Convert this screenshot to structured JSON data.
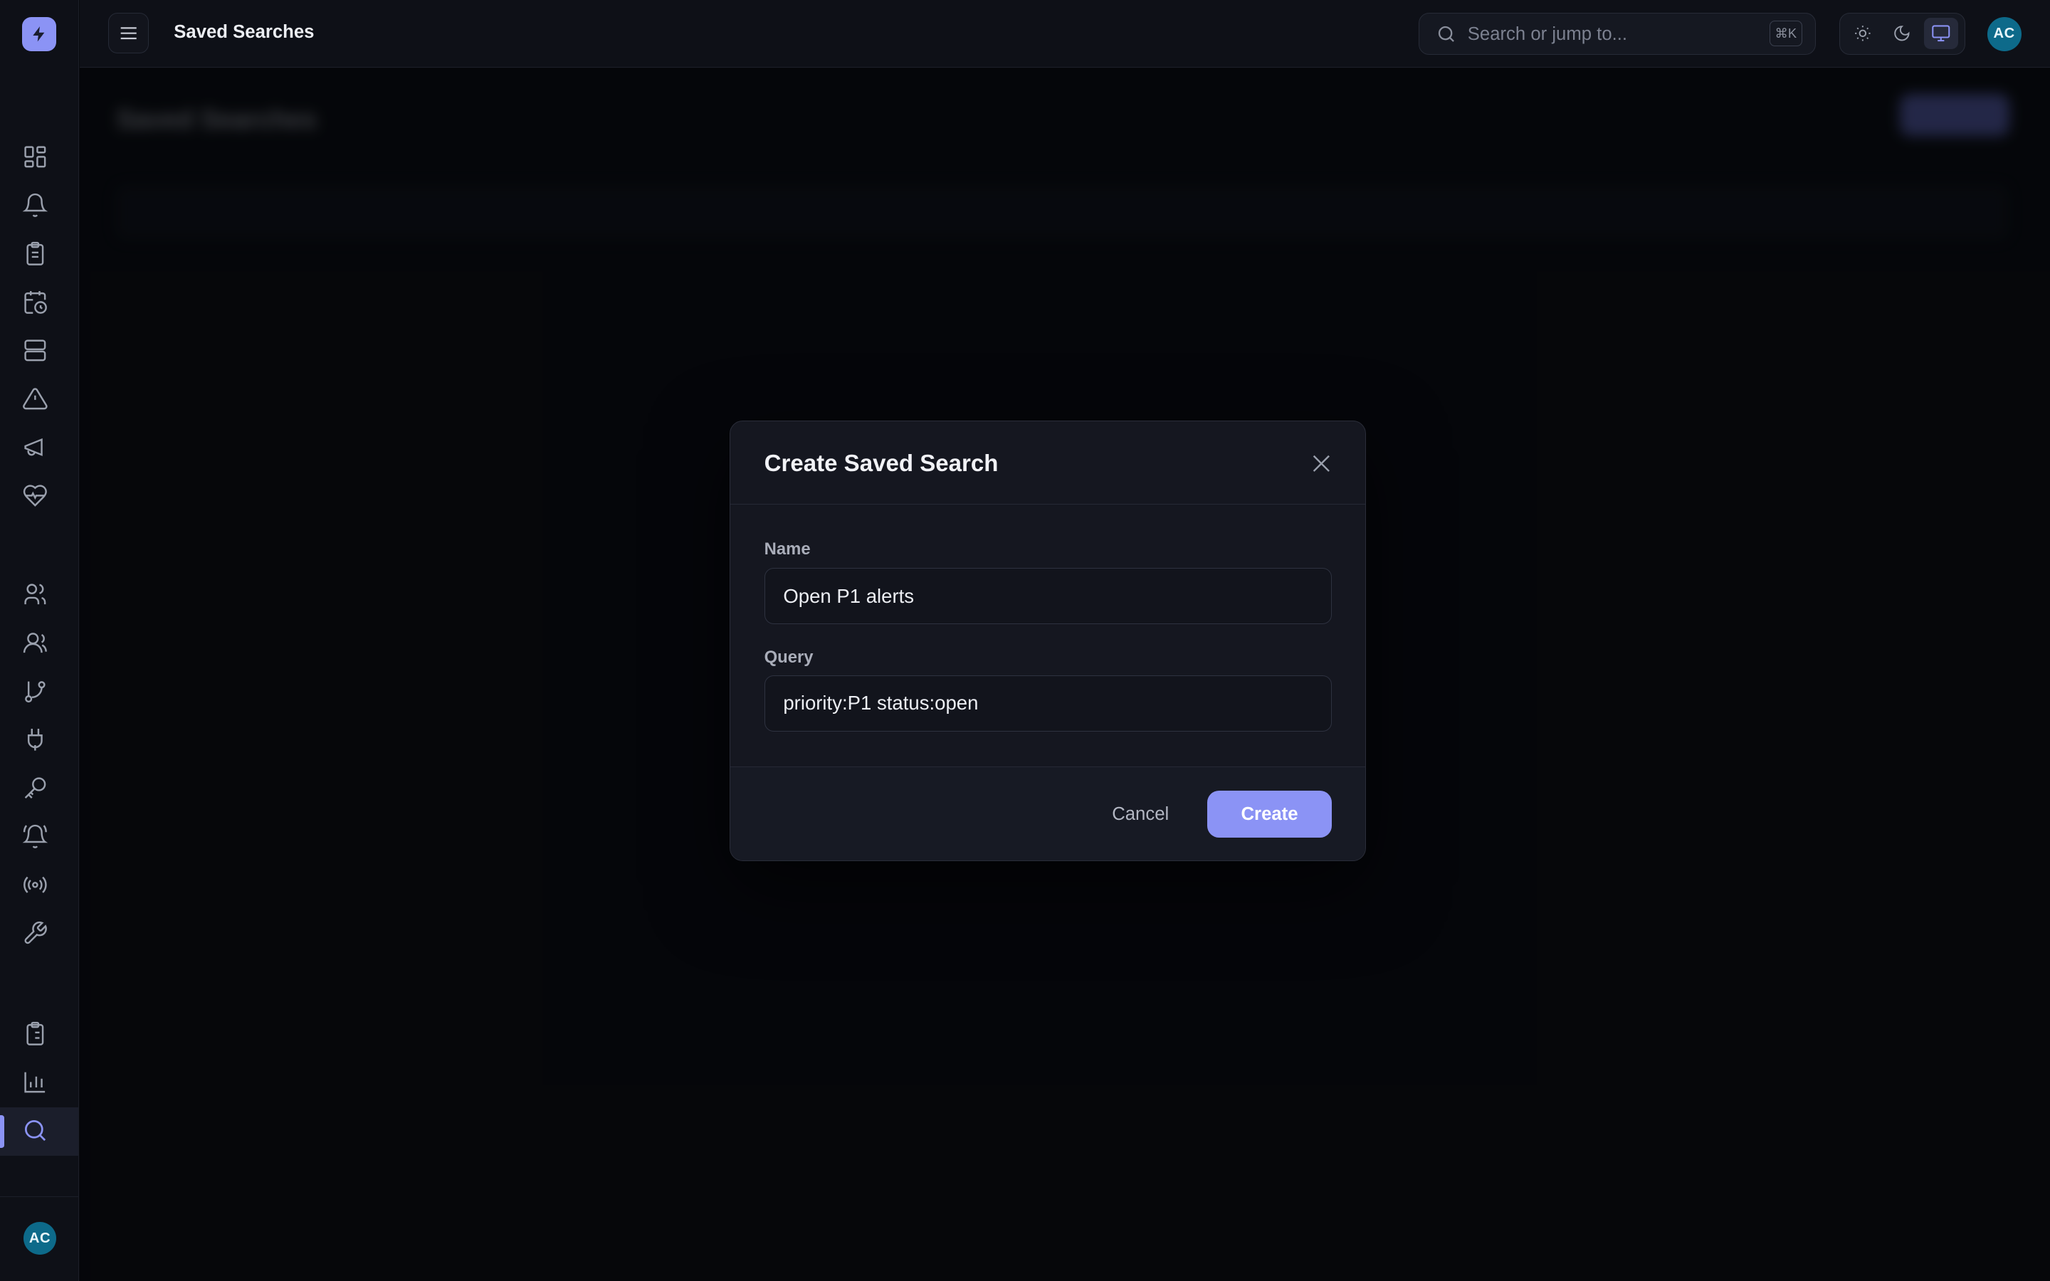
{
  "topbar": {
    "title": "Saved Searches",
    "search_placeholder": "Search or jump to...",
    "search_shortcut": "⌘K",
    "theme_options": [
      "light",
      "dark",
      "system"
    ],
    "active_theme": "system",
    "user_initials": "AC"
  },
  "sidebar": {
    "active_item": "saved-searches",
    "user_initials": "AC",
    "groups": [
      [
        "dashboard-icon",
        "bell-icon",
        "clipboard-icon",
        "calendar-clock-icon",
        "server-icon",
        "alert-triangle-icon",
        "megaphone-icon",
        "heart-pulse-icon"
      ],
      [
        "user-icon",
        "users-icon",
        "git-branch-icon",
        "plug-icon",
        "key-icon",
        "bell-ring-icon",
        "broadcast-icon",
        "wrench-icon"
      ],
      [
        "clipboard-list-icon",
        "bar-chart-icon",
        "search-icon"
      ]
    ]
  },
  "modal": {
    "title": "Create Saved Search",
    "name_label": "Name",
    "name_value": "Open P1 alerts",
    "query_label": "Query",
    "query_value": "priority:P1 status:open",
    "cancel_label": "Cancel",
    "create_label": "Create"
  },
  "colors": {
    "accent": "#8b93f5",
    "background": "#08090d",
    "panel": "#151720",
    "avatar": "#0d6a8a"
  }
}
